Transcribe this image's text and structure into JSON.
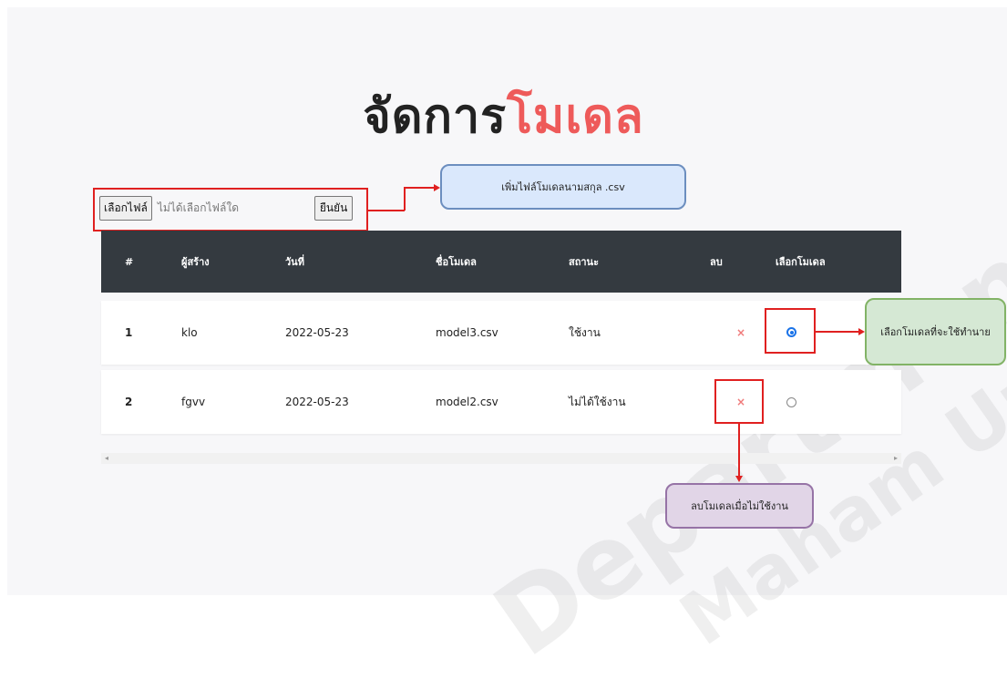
{
  "title": {
    "part1": "จัดการ",
    "part2": "โมเดล"
  },
  "upload": {
    "choose_label": "เลือกไฟล์",
    "no_file_text": "ไม่ได้เลือกไฟล์ใด",
    "confirm_label": "ยืนยัน"
  },
  "table": {
    "headers": [
      "#",
      "ผู้สร้าง",
      "วันที่",
      "ชื่อโมเดล",
      "สถานะ",
      "ลบ",
      "เลือกโมเดล"
    ],
    "rows": [
      {
        "num": "1",
        "creator": "klo",
        "date": "2022-05-23",
        "model": "model3.csv",
        "status": "ใช้งาน",
        "delete": "×",
        "selected": true
      },
      {
        "num": "2",
        "creator": "fgvv",
        "date": "2022-05-23",
        "model": "model2.csv",
        "status": "ไม่ได้ใช้งาน",
        "delete": "×",
        "selected": false
      }
    ]
  },
  "annotations": {
    "upload_note": "เพิ่มไฟล์โมเดลนามสกุล .csv",
    "select_note": "เลือกโมเดลที่จะใช้ทำนาย",
    "delete_note": "ลบโมเดลเมื่อไม่ใช้งาน"
  },
  "scroll": {
    "left": "◂",
    "right": "▸"
  },
  "colors": {
    "header_bg": "#343a40",
    "title_accent": "#ee5a5a",
    "highlight": "#e02020"
  }
}
